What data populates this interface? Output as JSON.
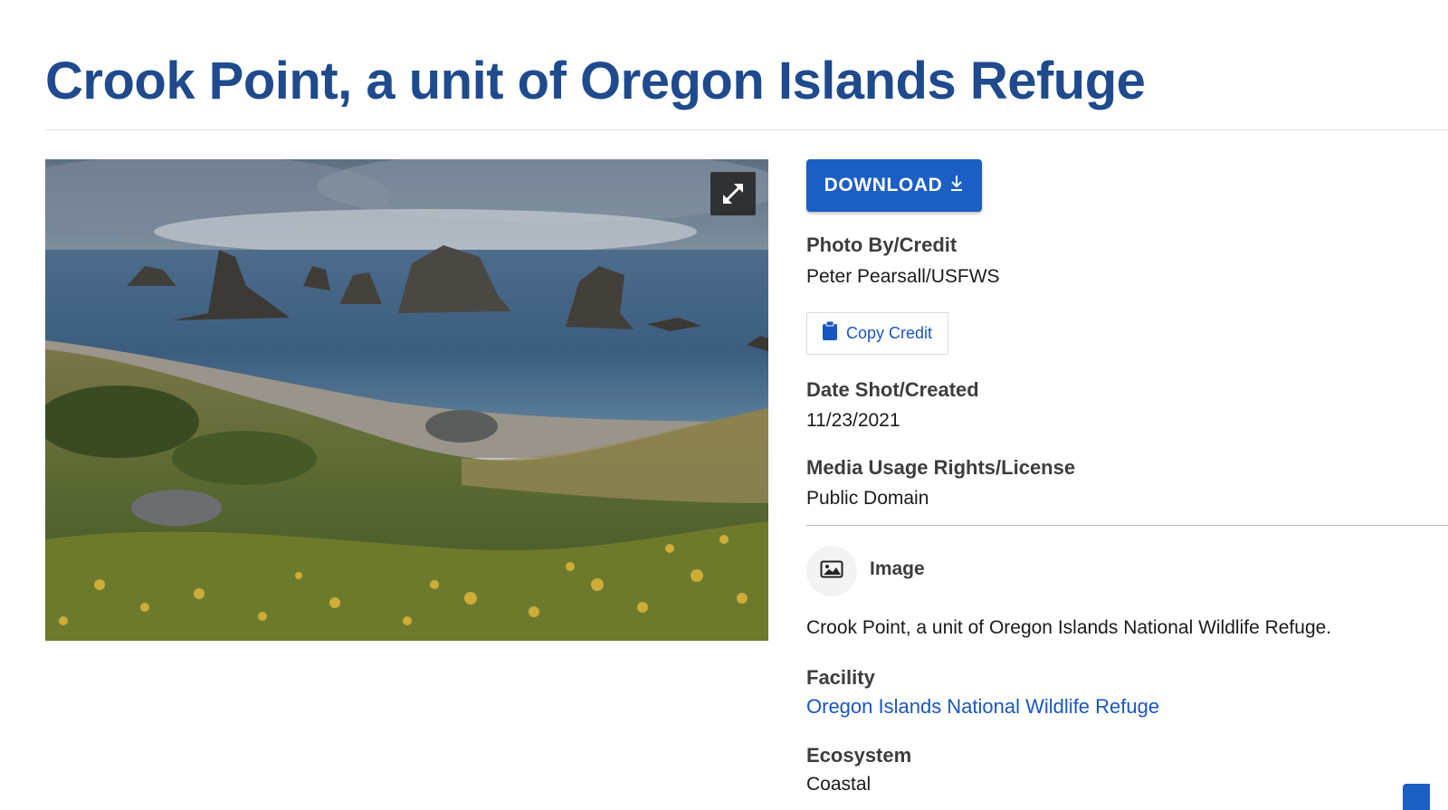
{
  "page": {
    "title": "Crook Point, a unit of Oregon Islands Refuge"
  },
  "photo": {
    "alt": "Crook Point, a unit of Oregon Islands National Wildlife Refuge.",
    "expand_icon": "expand-arrows-icon"
  },
  "sidebar": {
    "download_label": "DOWNLOAD",
    "download_icon": "download-arrow-icon",
    "credit_heading": "Photo By/Credit",
    "credit_value": "Peter Pearsall/USFWS",
    "copy_credit_label": "Copy Credit",
    "copy_credit_icon": "clipboard-icon",
    "date_heading": "Date Shot/Created",
    "date_value": "11/23/2021",
    "rights_heading": "Media Usage Rights/License",
    "rights_value": "Public Domain",
    "media_type_icon": "image-icon",
    "media_type_label": "Image",
    "description": "Crook Point, a unit of Oregon Islands National Wildlife Refuge.",
    "facility_heading": "Facility",
    "facility_link": "Oregon Islands National Wildlife Refuge",
    "ecosystem_heading": "Ecosystem",
    "ecosystem_value": "Coastal"
  },
  "colors": {
    "title_blue": "#1f4a8d",
    "button_blue": "#1c5ec4",
    "link_blue": "#1a56c2",
    "heading_gray": "#3d3d3d"
  }
}
